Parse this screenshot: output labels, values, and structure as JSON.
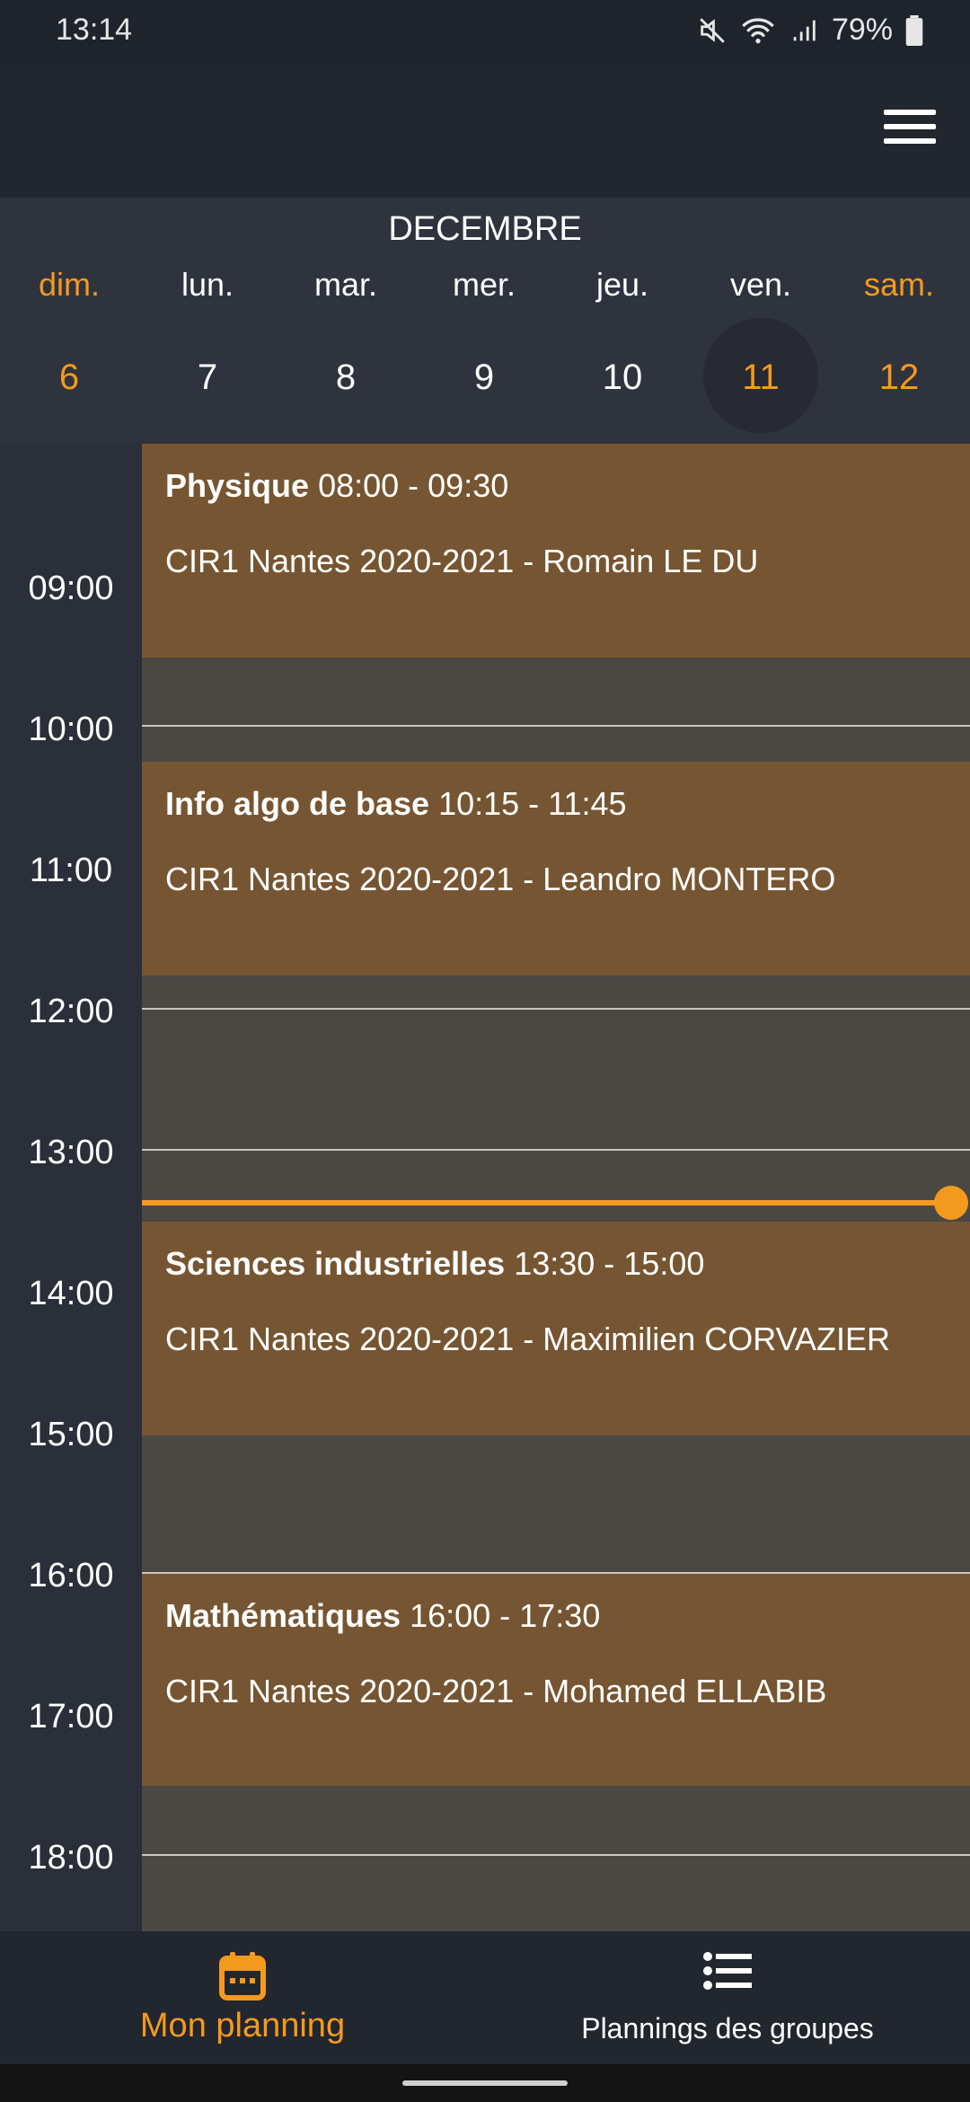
{
  "status_bar": {
    "time": "13:14",
    "battery": "79%"
  },
  "header": {
    "month": "DECEMBRE"
  },
  "week": [
    {
      "name": "dim.",
      "num": "6"
    },
    {
      "name": "lun.",
      "num": "7"
    },
    {
      "name": "mar.",
      "num": "8"
    },
    {
      "name": "mer.",
      "num": "9"
    },
    {
      "name": "jeu.",
      "num": "10"
    },
    {
      "name": "ven.",
      "num": "11"
    },
    {
      "name": "sam.",
      "num": "12"
    }
  ],
  "hours": [
    "09:00",
    "10:00",
    "11:00",
    "12:00",
    "13:00",
    "14:00",
    "15:00",
    "16:00",
    "17:00",
    "18:00"
  ],
  "events": [
    {
      "title": "Physique",
      "time": "08:00 - 09:30",
      "desc": "CIR1 Nantes 2020-2021 - Romain LE DU"
    },
    {
      "title": "Info algo de base",
      "time": "10:15 - 11:45",
      "desc": "CIR1 Nantes 2020-2021 - Leandro MONTERO"
    },
    {
      "title": "Sciences industrielles",
      "time": "13:30 - 15:00",
      "desc": "CIR1 Nantes 2020-2021 - Maximilien CORVAZIER"
    },
    {
      "title": "Mathématiques",
      "time": "16:00 - 17:30",
      "desc": "CIR1 Nantes 2020-2021 - Mohamed ELLABIB"
    }
  ],
  "bottom_nav": {
    "my_planning": "Mon planning",
    "group_plannings": "Plannings des groupes"
  },
  "colors": {
    "accent": "#f39a1e",
    "event": "#765632"
  }
}
